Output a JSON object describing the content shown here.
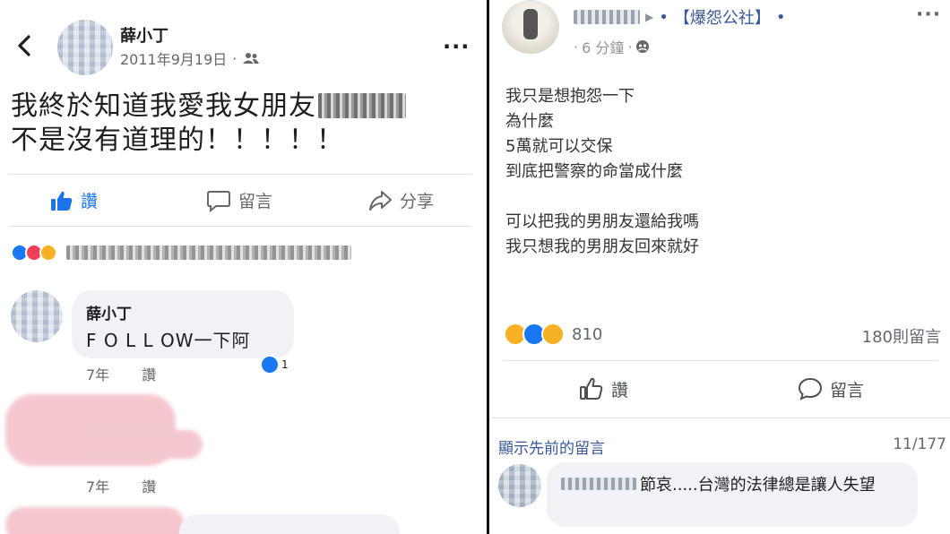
{
  "left_post": {
    "author_name": "薛小丁",
    "date": "2011年9月19日",
    "separator": "·",
    "text_line1": "我終於知道我愛我女朋友",
    "text_line2": "不是沒有道理的！！！！！",
    "actions": {
      "like": "讚",
      "comment": "留言",
      "share": "分享"
    },
    "comments": [
      {
        "author": "薛小丁",
        "text": "F O L L OW一下阿",
        "age": "7年",
        "like_label": "讚",
        "reaction_count": "1"
      },
      {
        "author": "",
        "text": "",
        "age": "7年",
        "like_label": "讚"
      }
    ]
  },
  "right_post": {
    "group_name": "【爆怨公社】",
    "bullet": "•",
    "time": "6 分鐘",
    "separator": "·",
    "text_lines": [
      "我只是想抱怨一下",
      "為什麼",
      "5萬就可以交保",
      "到底把警察的命當成什麼",
      "",
      "可以把我的男朋友還給我嗎",
      "我只想我的男朋友回來就好"
    ],
    "reaction_count": "810",
    "comment_count": "180則留言",
    "actions": {
      "like": "讚",
      "comment": "留言"
    },
    "show_previous": "顯示先前的留言",
    "page_count": "11/177",
    "comment": {
      "text": "節哀.....台灣的法律總是讓人失望"
    }
  },
  "colors": {
    "like_blue": "#1877f2",
    "link_blue": "#385898",
    "muted": "#65676b",
    "bubble": "#f0f2f5"
  }
}
